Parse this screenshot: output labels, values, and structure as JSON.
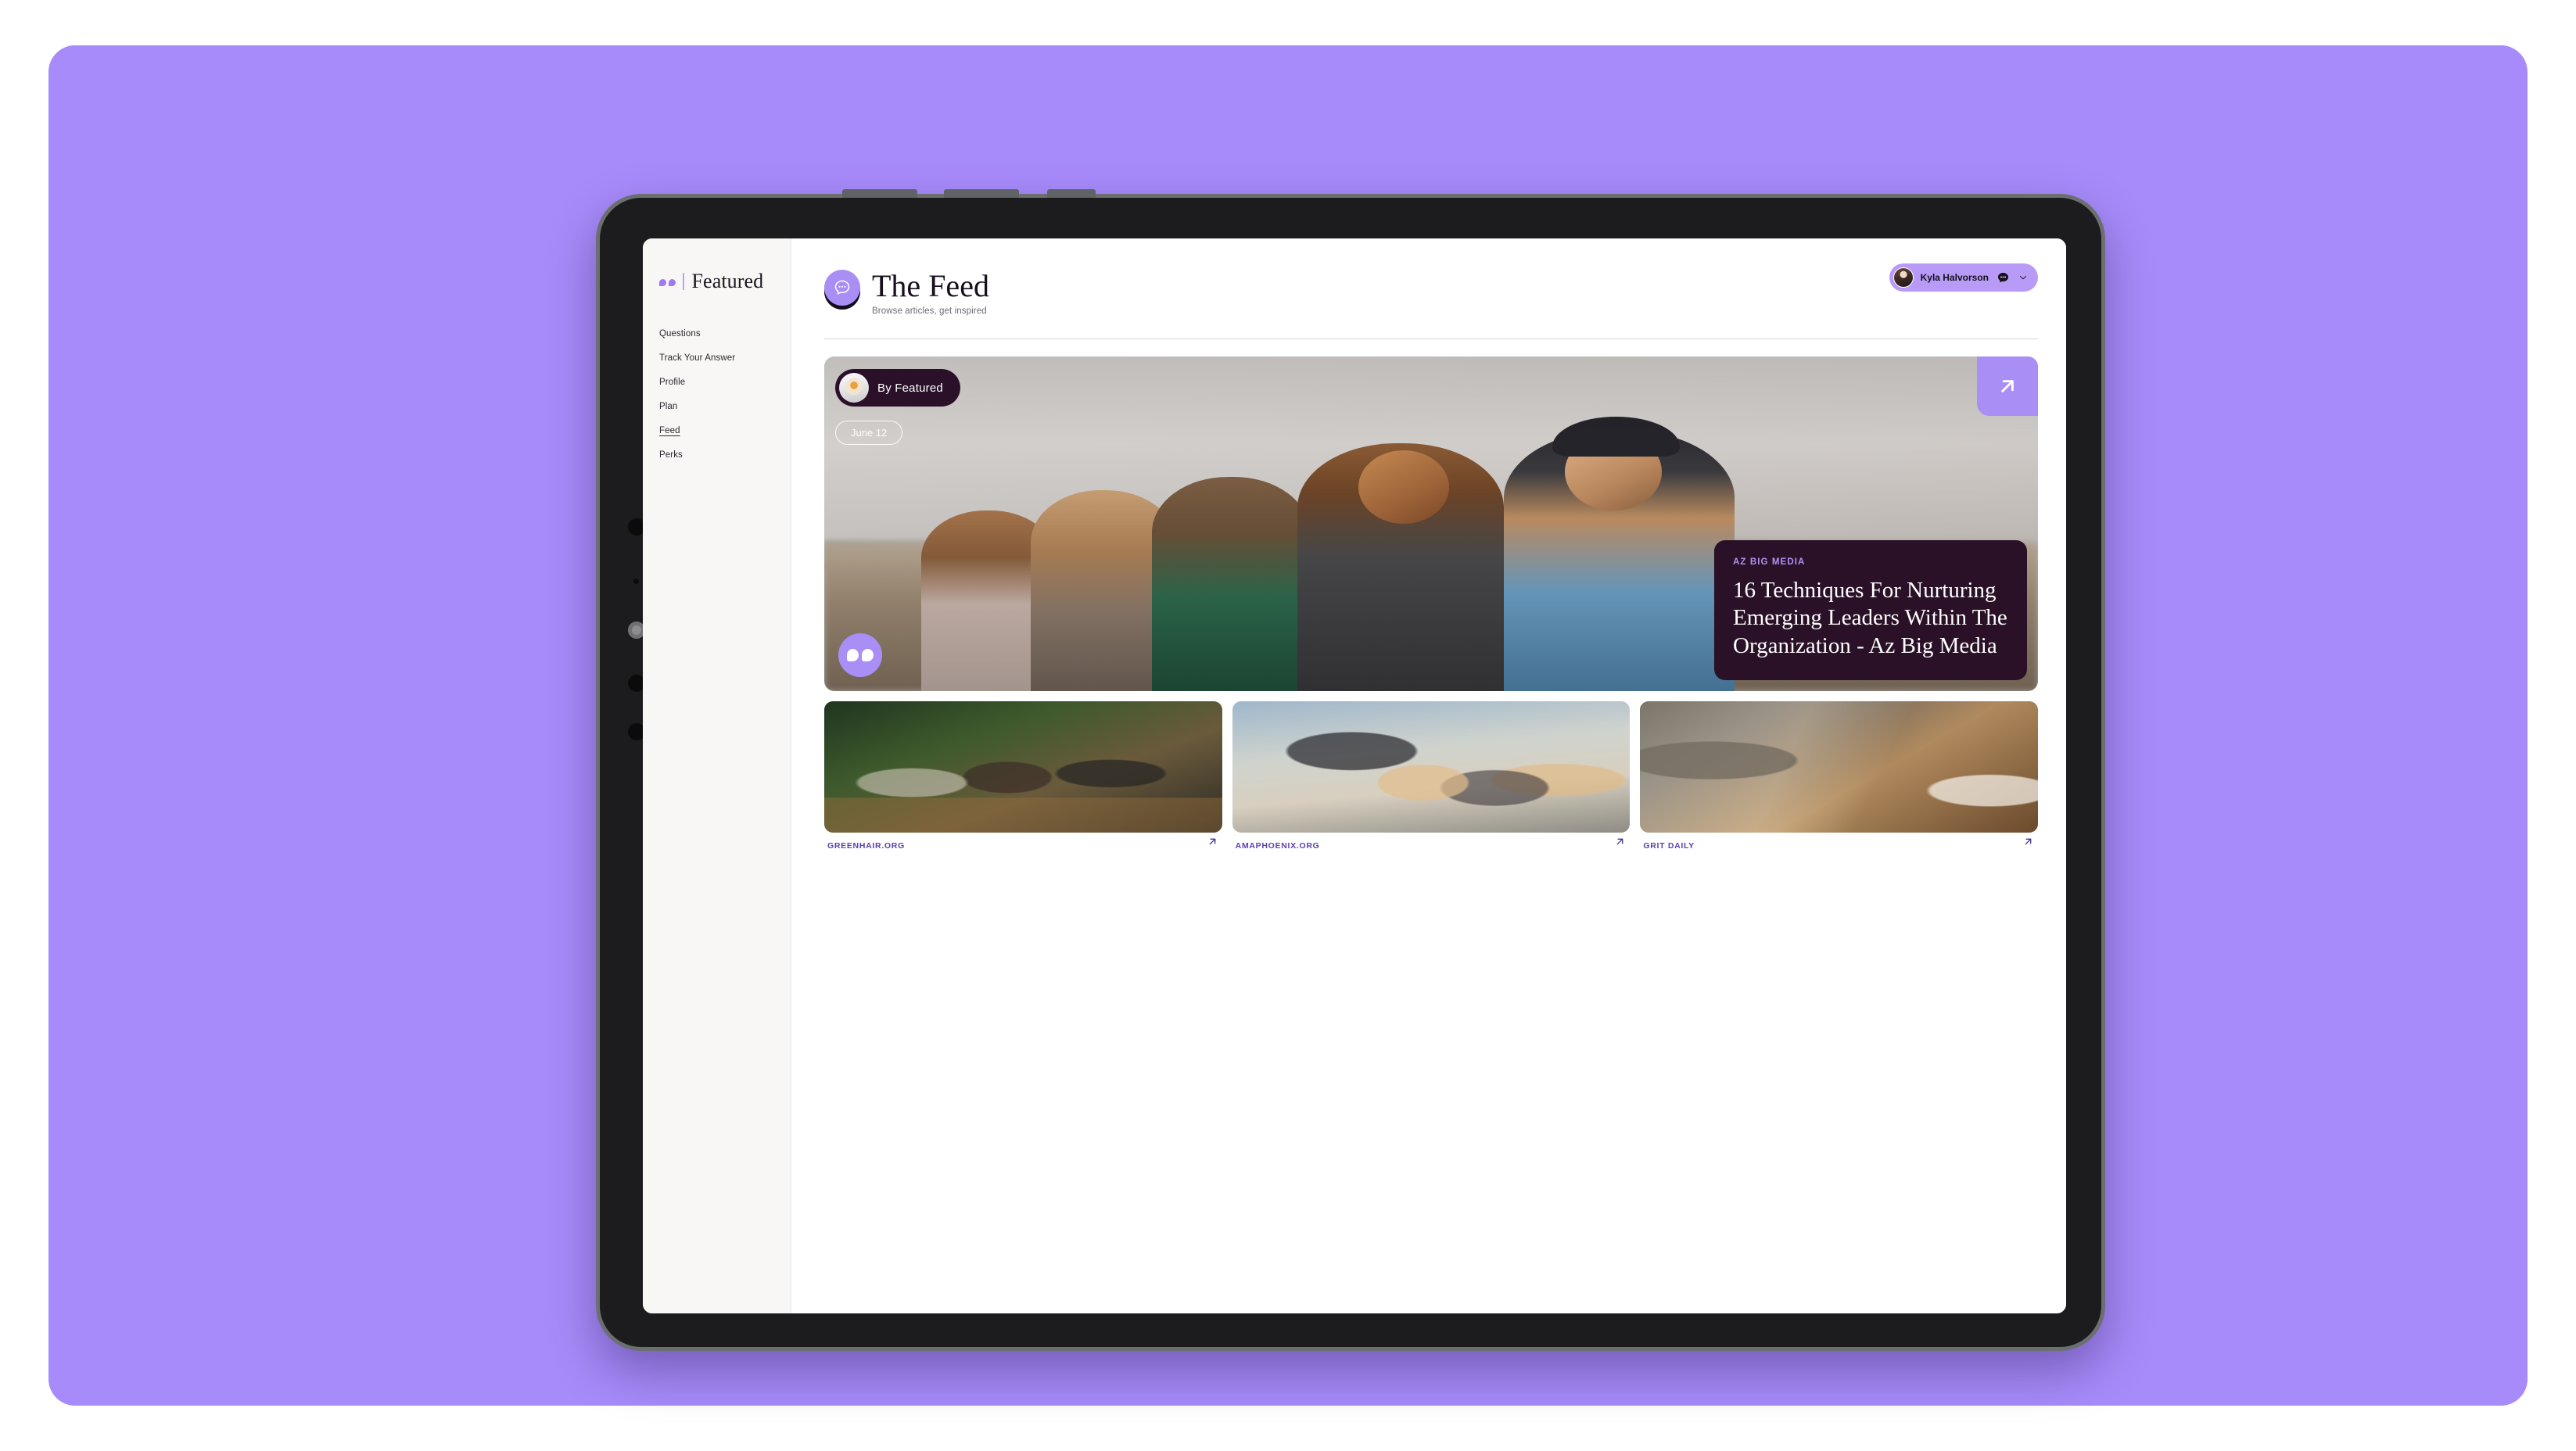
{
  "brand": {
    "name": "Featured"
  },
  "sidebar": {
    "items": [
      {
        "label": "Questions",
        "active": false
      },
      {
        "label": "Track Your Answer",
        "active": false
      },
      {
        "label": "Profile",
        "active": false
      },
      {
        "label": "Plan",
        "active": false
      },
      {
        "label": "Feed",
        "active": true
      },
      {
        "label": "Perks",
        "active": false
      }
    ]
  },
  "header": {
    "title": "The Feed",
    "subtitle": "Browse articles, get inspired",
    "icon": "chat-bubble-icon"
  },
  "user": {
    "name": "Kyla Halvorson",
    "avatar_icon": "user-avatar",
    "messages_icon": "chat-bubble-icon",
    "chevron_icon": "chevron-down-icon"
  },
  "hero": {
    "author_label": "By Featured",
    "author_avatar_icon": "coffee-cup-avatar",
    "date": "June 12",
    "quote_icon": "quote-icon",
    "open_icon": "arrow-up-right-icon",
    "source": "AZ BIG MEDIA",
    "title": "16 Techniques For Nurturing Emerging Leaders Within The Organization - Az Big Media"
  },
  "thumbnails": [
    {
      "source": "GREENHAIR.ORG",
      "arrow_icon": "arrow-up-right-icon"
    },
    {
      "source": "AMAPHOENIX.ORG",
      "arrow_icon": "arrow-up-right-icon"
    },
    {
      "source": "GRIT DAILY",
      "arrow_icon": "arrow-up-right-icon"
    }
  ],
  "colors": {
    "background": "#a78bfa",
    "accent": "#a98ef5",
    "card_dark": "#2a1128",
    "source_purple": "#b292f2",
    "link_purple": "#5b3fb0",
    "sidebar_bg": "#f8f7f5"
  }
}
